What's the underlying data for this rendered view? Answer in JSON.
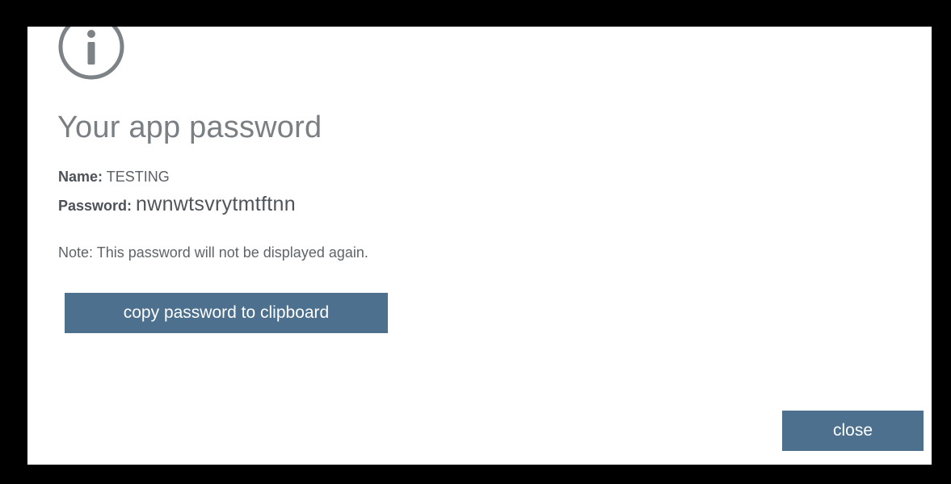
{
  "dialog": {
    "icon": "info-icon",
    "title": "Your app password",
    "name_label": "Name:",
    "name_value": "TESTING",
    "password_label": "Password:",
    "password_value": "nwnwtsvrytmtftnn",
    "note": "Note: This password will not be displayed again.",
    "copy_button_label": "copy password to clipboard",
    "close_button_label": "close"
  },
  "colors": {
    "button_background": "#4c708e",
    "icon_stroke": "#7d8286",
    "title_text": "#7a7f84",
    "frame": "#000000"
  }
}
